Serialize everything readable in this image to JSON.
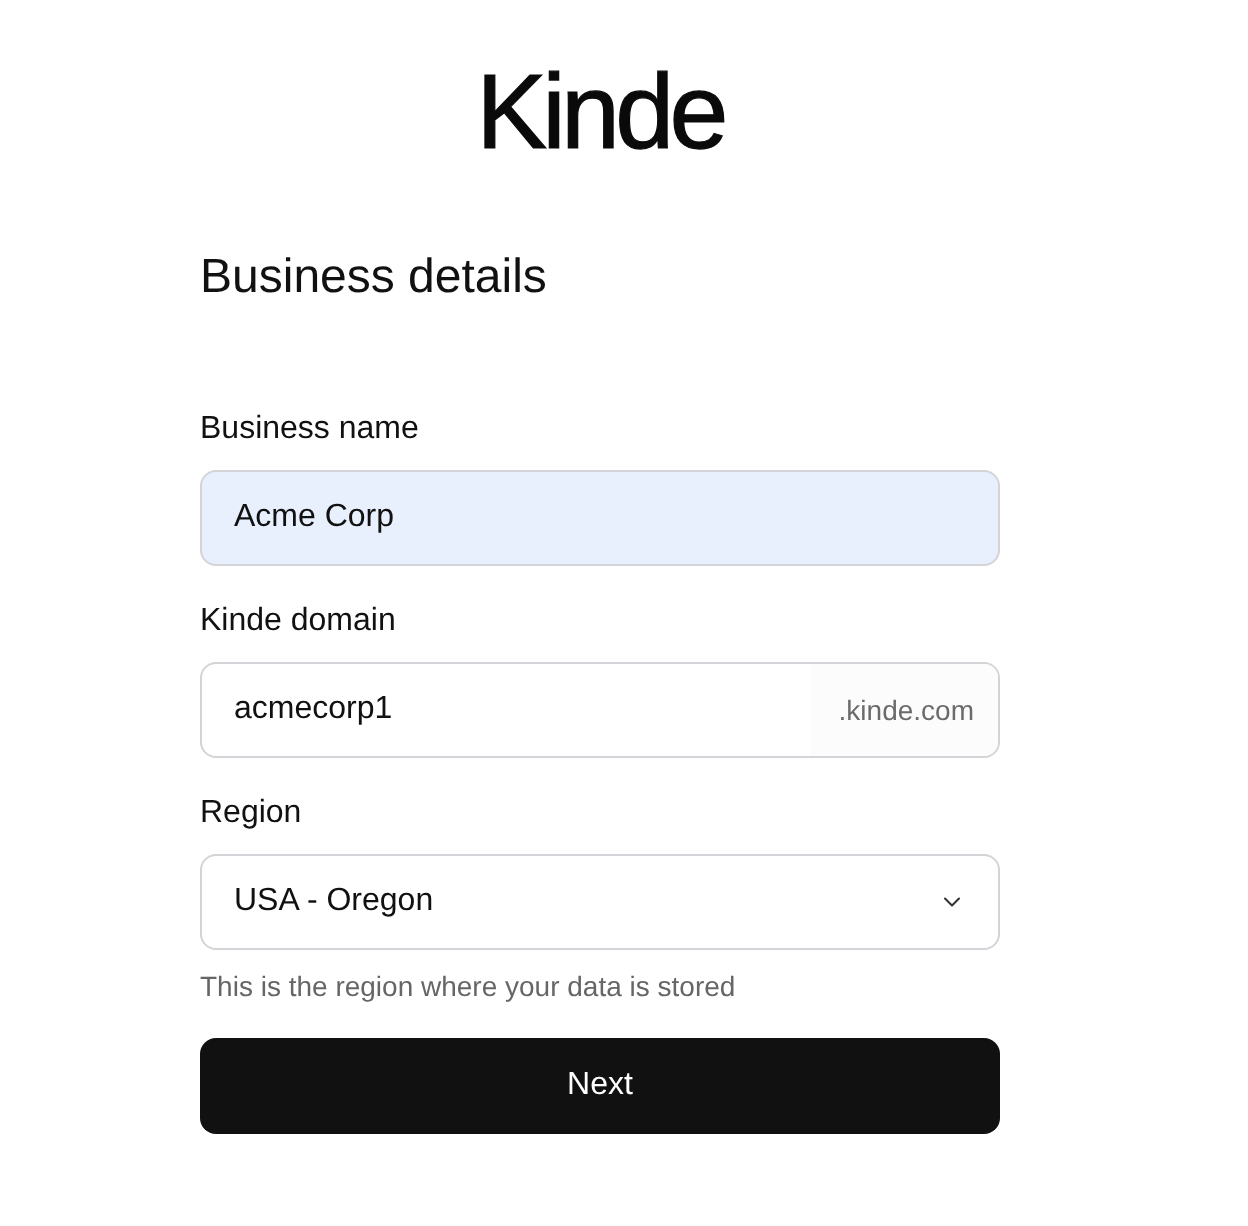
{
  "logo": {
    "text": "Kinde"
  },
  "title": "Business details",
  "fields": [
    {
      "kind": "text",
      "label": "Business name",
      "value": "Acme Corp",
      "autofilled": true
    },
    {
      "kind": "suffix",
      "label": "Kinde domain",
      "value": "acmecorp1",
      "suffix": ".kinde.com",
      "autofilled": false
    },
    {
      "kind": "select",
      "label": "Region",
      "value": "USA - Oregon",
      "hint": "This is the region where your data is stored",
      "autofilled": false
    }
  ],
  "button": {
    "label": "Next"
  }
}
